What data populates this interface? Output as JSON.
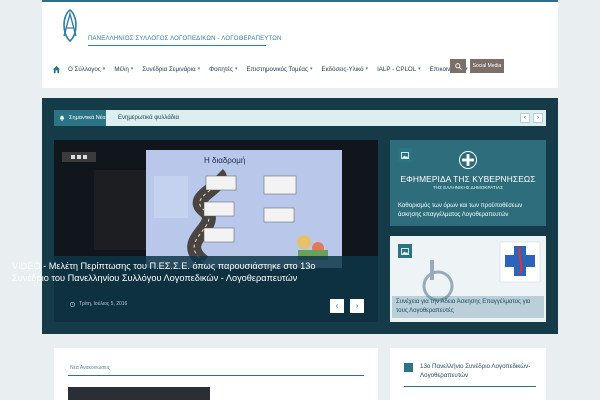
{
  "header": {
    "org_name": "ΠΑΝΕΛΛΗΝΙΟΣ ΣΥΛΛΟΓΟΣ ΛΟΓΟΠΕΔΙΚΩΝ - ΛΟΓΟΘΕΡΑΠΕΥΤΩΝ",
    "search_icon": "search-icon",
    "social_label": "Social Media"
  },
  "nav": {
    "items": [
      {
        "label": "Ο Σύλλογος"
      },
      {
        "label": "Μέλη"
      },
      {
        "label": "Συνέδρια Σεμινάρια"
      },
      {
        "label": "Φοιτητές"
      },
      {
        "label": "Επιστημονικός Τομέας"
      },
      {
        "label": "Εκδόσεις-Υλικό"
      },
      {
        "label": "IALP - CPLOL"
      },
      {
        "label": "Επικοινωνία"
      }
    ]
  },
  "ticker": {
    "label": "Σημαντικά Νέα",
    "text": "Ενημερωτικά φυλλάδια"
  },
  "featured": {
    "slide_heading": "Η διαδρομή",
    "title": "VIDEO - Μελέτη Περίπτωσης του Π.ΕΣ.Σ.Ε. όπως παρουσιάστηκε στο 13ο Συνέδριο του Πανελληνίου Συλλόγου Λογοπεδικών - Λογοθεραπευτών",
    "date": "Τρίτη, Ιούλιος 5, 2016",
    "prev": "‹",
    "next": "›"
  },
  "cards": [
    {
      "gov_title": "ΕΦΗΜΕΡΙΔΑ ΤΗΣ ΚΥΒΕΡΝΗΣΕΩΣ",
      "gov_subtitle": "ΤΗΣ ΕΛΛΗΝΙΚΗΣ ΔΗΜΟΚΡΑΤΙΑΣ",
      "caption": "Καθορισμός των όρων και των προϋποθέσεων άσκησης επαγγέλματος Λογοθεραπευτών"
    },
    {
      "caption": "Συνέχεια για την Άδεια Άσκησης Επαγγέλματος για τους Λογοθεραπευτές"
    }
  ],
  "bottom": {
    "left_heading": "Νέα Ανακοινώσεις",
    "right_text": "13ο Πανελλήνιο Συνέδριο Λογοπεδικών-Λογοθεραπευτών"
  },
  "colors": {
    "accent": "#2c7383",
    "band": "#153b49",
    "button": "#7c6f68"
  }
}
